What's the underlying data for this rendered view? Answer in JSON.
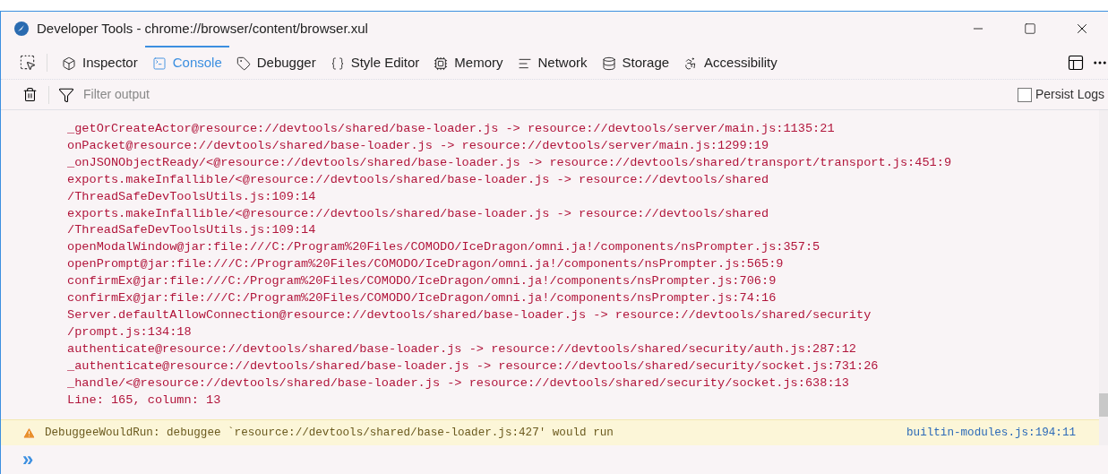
{
  "window": {
    "title": "Developer Tools - chrome://browser/content/browser.xul"
  },
  "tabs": [
    {
      "label": "Inspector",
      "kind": "inspector",
      "selected": false
    },
    {
      "label": "Console",
      "kind": "console",
      "selected": true
    },
    {
      "label": "Debugger",
      "kind": "debugger",
      "selected": false
    },
    {
      "label": "Style Editor",
      "kind": "style",
      "selected": false
    },
    {
      "label": "Memory",
      "kind": "memory",
      "selected": false
    },
    {
      "label": "Network",
      "kind": "network",
      "selected": false
    },
    {
      "label": "Storage",
      "kind": "storage",
      "selected": false
    },
    {
      "label": "Accessibility",
      "kind": "accessibility",
      "selected": false
    }
  ],
  "filter": {
    "placeholder": "Filter output",
    "persist_logs": {
      "label": "Persist Logs",
      "checked": false
    }
  },
  "error_lines": [
    "_getOrCreateActor@resource://devtools/shared/base-loader.js -> resource://devtools/server/main.js:1135:21",
    "onPacket@resource://devtools/shared/base-loader.js -> resource://devtools/server/main.js:1299:19",
    "_onJSONObjectReady/<@resource://devtools/shared/base-loader.js -> resource://devtools/shared/transport/transport.js:451:9",
    "exports.makeInfallible/<@resource://devtools/shared/base-loader.js -> resource://devtools/shared",
    "/ThreadSafeDevToolsUtils.js:109:14",
    "exports.makeInfallible/<@resource://devtools/shared/base-loader.js -> resource://devtools/shared",
    "/ThreadSafeDevToolsUtils.js:109:14",
    "openModalWindow@jar:file:///C:/Program%20Files/COMODO/IceDragon/omni.ja!/components/nsPrompter.js:357:5",
    "openPrompt@jar:file:///C:/Program%20Files/COMODO/IceDragon/omni.ja!/components/nsPrompter.js:565:9",
    "confirmEx@jar:file:///C:/Program%20Files/COMODO/IceDragon/omni.ja!/components/nsPrompter.js:706:9",
    "confirmEx@jar:file:///C:/Program%20Files/COMODO/IceDragon/omni.ja!/components/nsPrompter.js:74:16",
    "Server.defaultAllowConnection@resource://devtools/shared/base-loader.js -> resource://devtools/shared/security",
    "/prompt.js:134:18",
    "authenticate@resource://devtools/shared/base-loader.js -> resource://devtools/shared/security/auth.js:287:12",
    "_authenticate@resource://devtools/shared/base-loader.js -> resource://devtools/shared/security/socket.js:731:26",
    "_handle/<@resource://devtools/shared/base-loader.js -> resource://devtools/shared/security/socket.js:638:13",
    "Line: 165, column: 13"
  ],
  "warning": {
    "message": "DebuggeeWouldRun: debuggee `resource://devtools/shared/base-loader.js:427' would run",
    "location": "builtin-modules.js:194:11"
  },
  "prompt": {
    "symbol": "»"
  }
}
